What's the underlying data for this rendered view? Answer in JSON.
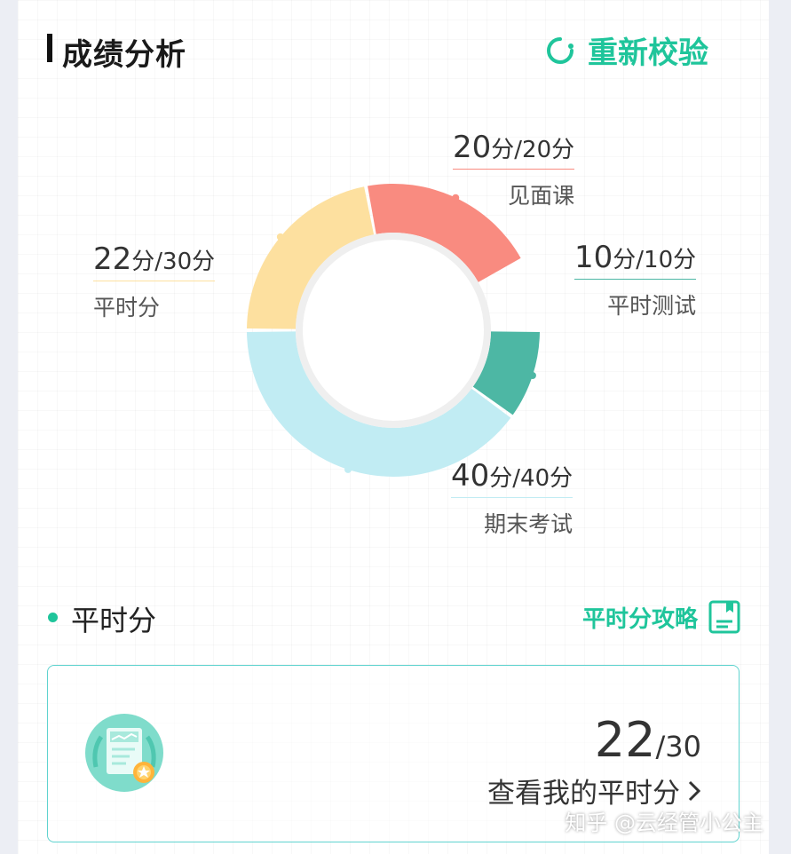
{
  "header": {
    "title": "成绩分析",
    "recheck_label": "重新校验",
    "recheck_icon": "refresh-icon"
  },
  "chart_data": {
    "type": "pie",
    "variant": "donut",
    "total": 100,
    "segments": [
      {
        "name": "平时测试",
        "value": 10,
        "max": 10,
        "score_text": "10",
        "max_text": "/10分",
        "color": "#4db7a4"
      },
      {
        "name": "期末考试",
        "value": 40,
        "max": 40,
        "score_text": "40",
        "max_text": "/40分",
        "color": "#c1ecf3"
      },
      {
        "name": "平时分",
        "value": 22,
        "max": 30,
        "score_text": "22",
        "max_text": "/30分",
        "color": "#fde09f"
      },
      {
        "name": "见面课",
        "value": 20,
        "max": 20,
        "score_text": "20",
        "max_text": "/20分",
        "color": "#f98b80"
      }
    ],
    "unit": "分"
  },
  "section": {
    "title": "平时分",
    "strategy_label": "平时分攻略",
    "strategy_icon": "bookmark-document-icon",
    "score_value": "22",
    "score_max": "/30",
    "view_label": "查看我的平时分",
    "badge_icon": "certificate-badge-icon"
  },
  "watermark": "知乎 @云经管小公主",
  "colors": {
    "accent": "#1fc59b",
    "box_border": "#5fd3cf"
  }
}
